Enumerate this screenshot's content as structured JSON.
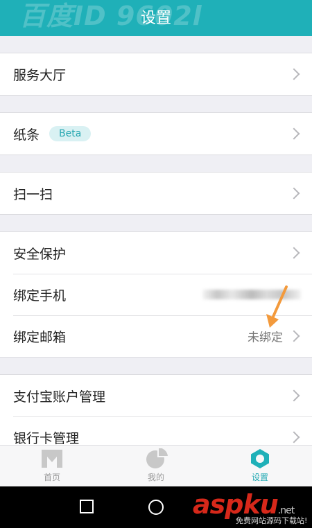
{
  "header": {
    "title": "设置",
    "watermark": "百度ID 9602l"
  },
  "groups": [
    {
      "items": [
        {
          "label": "服务大厅"
        }
      ]
    },
    {
      "items": [
        {
          "label": "纸条",
          "badge": "Beta"
        }
      ]
    },
    {
      "items": [
        {
          "label": "扫一扫"
        }
      ]
    },
    {
      "items": [
        {
          "label": "安全保护"
        },
        {
          "label": "绑定手机"
        },
        {
          "label": "绑定邮箱",
          "value": "未绑定"
        }
      ]
    },
    {
      "items": [
        {
          "label": "支付宝账户管理"
        },
        {
          "label": "银行卡管理"
        }
      ]
    }
  ],
  "tabbar": {
    "tabs": [
      {
        "label": "首页",
        "icon": "m-logo-icon",
        "active": false
      },
      {
        "label": "我的",
        "icon": "pie-chart-icon",
        "active": false
      },
      {
        "label": "设置",
        "icon": "gear-icon",
        "active": true
      }
    ]
  },
  "colors": {
    "accent": "#1fb0b8",
    "annotation_arrow": "#f39a3c",
    "watermark_red": "#d6281a"
  },
  "watermark_logo": {
    "text": "aspku",
    "suffix": ".net",
    "subtitle": "免费网站源码下载站!"
  }
}
